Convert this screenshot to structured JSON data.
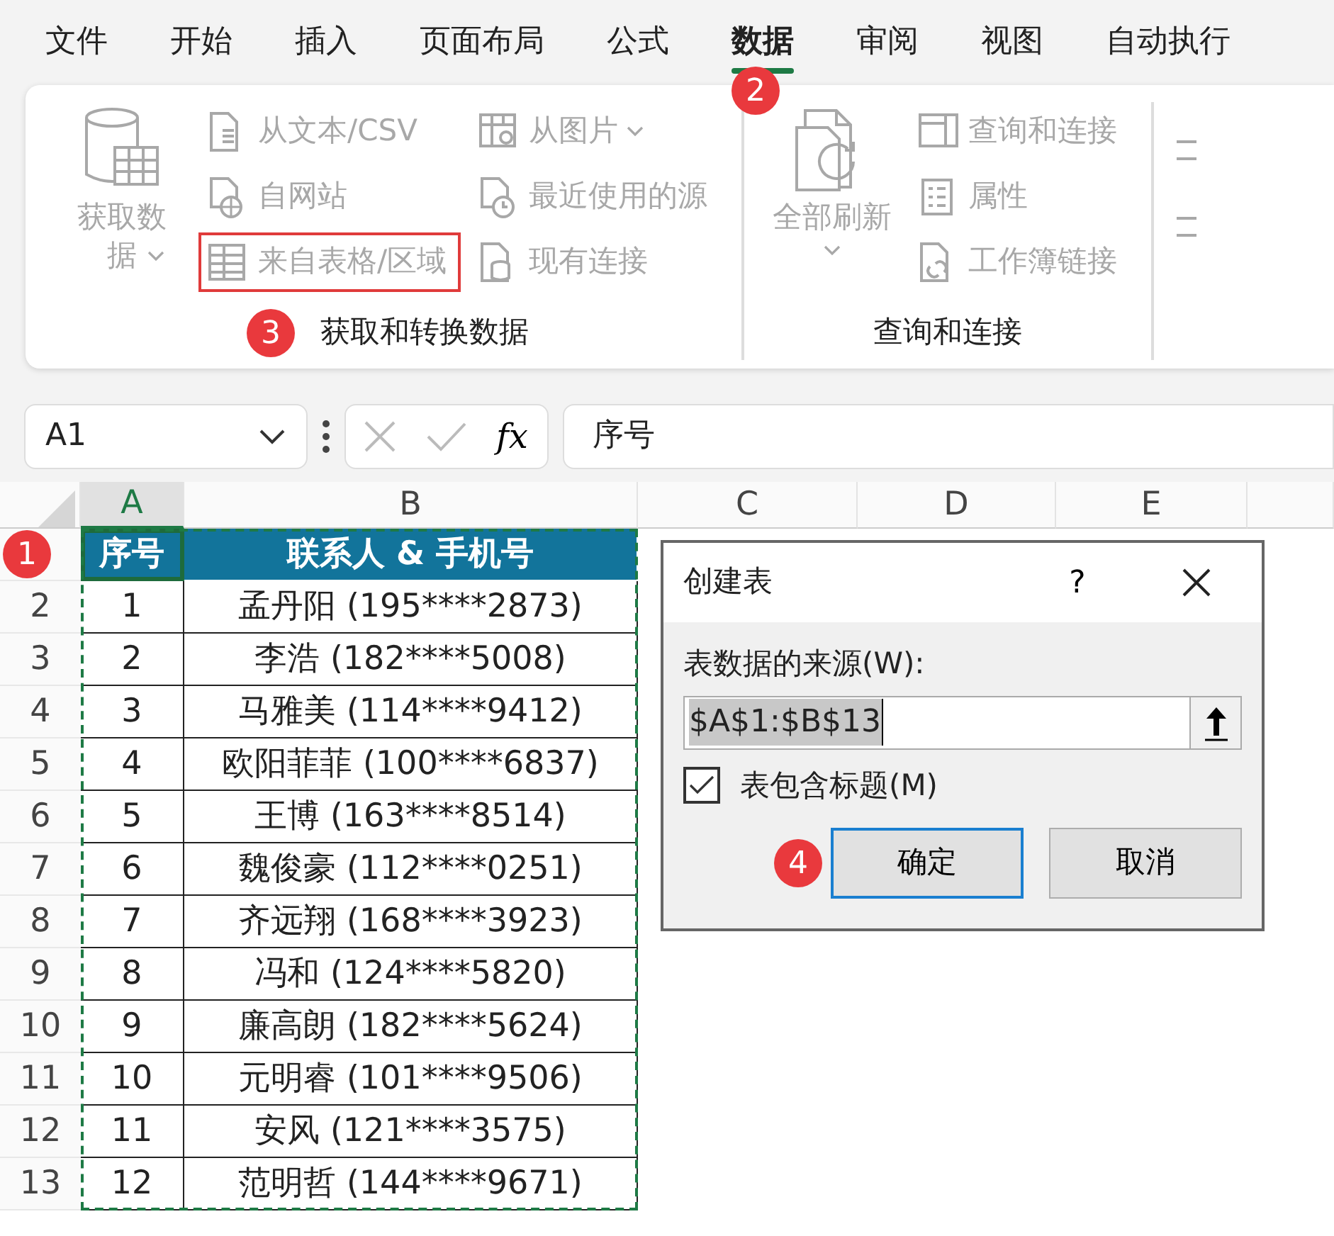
{
  "menu_tabs": [
    {
      "label": "文件",
      "selected": false
    },
    {
      "label": "开始",
      "selected": false
    },
    {
      "label": "插入",
      "selected": false
    },
    {
      "label": "页面布局",
      "selected": false
    },
    {
      "label": "公式",
      "selected": false
    },
    {
      "label": "数据",
      "selected": true,
      "callout": "2"
    },
    {
      "label": "审阅",
      "selected": false
    },
    {
      "label": "视图",
      "selected": false
    },
    {
      "label": "自动执行",
      "selected": false
    }
  ],
  "ribbon_groups": [
    {
      "label": "获取和转换数据",
      "callout": "3",
      "items": [
        {
          "label": "获取数据",
          "kind": "large",
          "disabled": true,
          "dropdown": true
        },
        {
          "label": "从文本/CSV",
          "kind": "small",
          "disabled": true
        },
        {
          "label": "自网站",
          "kind": "small",
          "disabled": true
        },
        {
          "label": "来自表格/区域",
          "kind": "small",
          "disabled": true,
          "highlighted": true
        },
        {
          "label": "从图片",
          "kind": "small",
          "disabled": true,
          "dropdown": true
        },
        {
          "label": "最近使用的源",
          "kind": "small",
          "disabled": true
        },
        {
          "label": "现有连接",
          "kind": "small",
          "disabled": true
        }
      ]
    },
    {
      "label": "查询和连接",
      "items": [
        {
          "label": "全部刷新",
          "kind": "large",
          "disabled": true,
          "dropdown": true
        },
        {
          "label": "查询和连接",
          "kind": "small",
          "disabled": true
        },
        {
          "label": "属性",
          "kind": "small",
          "disabled": true
        },
        {
          "label": "工作簿链接",
          "kind": "small",
          "disabled": true
        }
      ]
    }
  ],
  "formula_bar": {
    "name_box": "A1",
    "function_button": "fx",
    "formula": "序号"
  },
  "sheet": {
    "columns": [
      {
        "label": "A",
        "selected": true
      },
      {
        "label": "B",
        "selected": false
      },
      {
        "label": "C",
        "selected": false
      },
      {
        "label": "D",
        "selected": false
      },
      {
        "label": "E",
        "selected": false
      }
    ],
    "header_row": {
      "callout": "1",
      "cells": [
        "序号",
        "联系人 & 手机号"
      ]
    },
    "rows": [
      {
        "number": "2",
        "cells": [
          "1",
          "孟丹阳 (195****2873)"
        ]
      },
      {
        "number": "3",
        "cells": [
          "2",
          "李浩 (182****5008)"
        ]
      },
      {
        "number": "4",
        "cells": [
          "3",
          "马雅美 (114****9412)"
        ]
      },
      {
        "number": "5",
        "cells": [
          "4",
          "欧阳菲菲 (100****6837)"
        ]
      },
      {
        "number": "6",
        "cells": [
          "5",
          "王博 (163****8514)"
        ]
      },
      {
        "number": "7",
        "cells": [
          "6",
          "魏俊豪 (112****0251)"
        ]
      },
      {
        "number": "8",
        "cells": [
          "7",
          "齐远翔 (168****3923)"
        ]
      },
      {
        "number": "9",
        "cells": [
          "8",
          "冯和 (124****5820)"
        ]
      },
      {
        "number": "10",
        "cells": [
          "9",
          "廉高朗 (182****5624)"
        ]
      },
      {
        "number": "11",
        "cells": [
          "10",
          "元明睿 (101****9506)"
        ]
      },
      {
        "number": "12",
        "cells": [
          "11",
          "安风 (121****3575)"
        ]
      },
      {
        "number": "13",
        "cells": [
          "12",
          "范明哲 (144****9671)"
        ]
      }
    ]
  },
  "dialog": {
    "title": "创建表",
    "help": "?",
    "source_label": "表数据的来源(W):",
    "range": "$A$1:$B$13",
    "has_headers_label": "表包含标题(M)",
    "has_headers": true,
    "buttons": [
      {
        "label": "确定",
        "default": true,
        "callout": "4"
      },
      {
        "label": "取消",
        "default": false
      }
    ]
  }
}
